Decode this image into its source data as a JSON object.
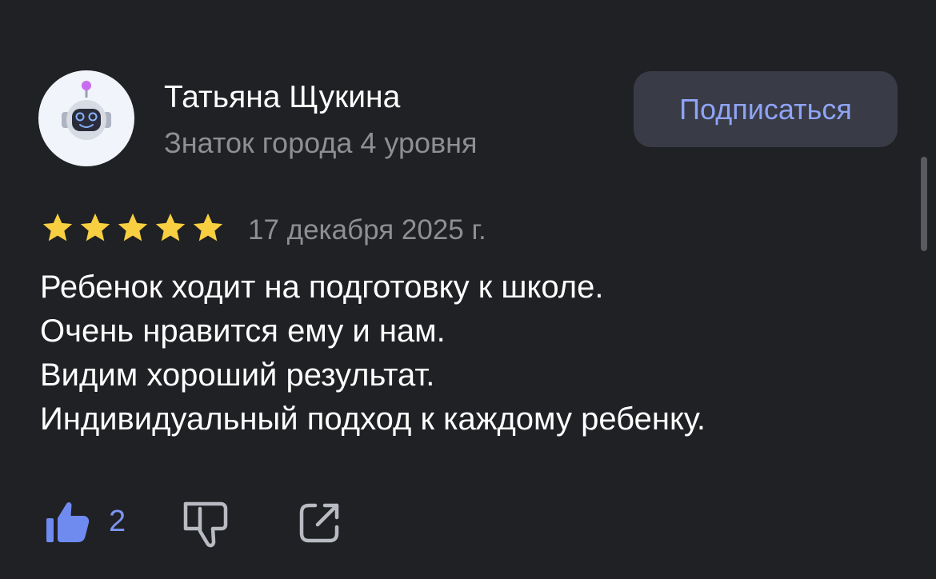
{
  "colors": {
    "background": "#202124",
    "accent_blue": "#7d95f2",
    "star_gold": "#f7cf40",
    "muted_text": "#8e8e93",
    "button_bg": "#393b47"
  },
  "author": {
    "avatar_icon": "robot-avatar-icon",
    "name": "Татьяна Щукина",
    "level": "Знаток города 4 уровня"
  },
  "subscribe": {
    "label": "Подписаться"
  },
  "review": {
    "rating": 5,
    "rating_max": 5,
    "date": "17 декабря 2025 г.",
    "lines": [
      "Ребенок ходит на подготовку к школе.",
      "Очень нравится ему и нам.",
      "Видим хороший результат.",
      "Индивидуальный подход к каждому ребенку."
    ]
  },
  "actions": {
    "like_icon": "thumbs-up-icon",
    "like_count": "2",
    "dislike_icon": "thumbs-down-icon",
    "share_icon": "share-icon"
  }
}
